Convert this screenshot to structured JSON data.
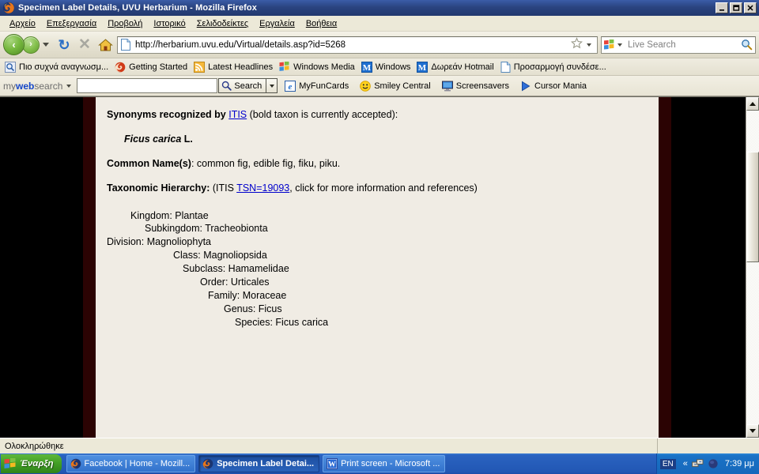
{
  "window": {
    "title": "Specimen Label Details, UVU Herbarium - Mozilla Firefox",
    "app_icon": "firefox-icon",
    "minimize_label": "_",
    "maximize_label": "❐",
    "close_label": "✕"
  },
  "menubar": {
    "items": [
      {
        "label": "Αρχείο",
        "accel": "Α"
      },
      {
        "label": "Επεξεργασία",
        "accel": "Ε"
      },
      {
        "label": "Προβολή",
        "accel": "β"
      },
      {
        "label": "Ιστορικό",
        "accel": "Ι"
      },
      {
        "label": "Σελιδοδείκτες",
        "accel": "Σ"
      },
      {
        "label": "Εργαλεία",
        "accel": "γ"
      },
      {
        "label": "Βοήθεια",
        "accel": "Β"
      }
    ]
  },
  "navbar": {
    "back_label": "‹",
    "forward_label": "›",
    "reload_label": "↻",
    "stop_label": "✕",
    "home_label": "home-icon",
    "url": "http://herbarium.uvu.edu/Virtual/details.asp?id=5268",
    "bookmark_star": "star-icon",
    "search_placeholder": "Live Search",
    "search_engine": "windows-live-icon",
    "search_go": "magnifier-icon"
  },
  "bookmarks": {
    "items": [
      {
        "label": "Πιο συχνά αναγνωσμ...",
        "icon": "most-visited-icon"
      },
      {
        "label": "Getting Started",
        "icon": "firefox-start-icon"
      },
      {
        "label": "Latest Headlines",
        "icon": "rss-icon"
      },
      {
        "label": "Windows Media",
        "icon": "windows-icon"
      },
      {
        "label": "Windows",
        "icon": "msn-icon"
      },
      {
        "label": "Δωρεάν Hotmail",
        "icon": "msn-icon"
      },
      {
        "label": "Προσαρμογή συνδέσε...",
        "icon": "page-icon"
      }
    ]
  },
  "mywebsearch": {
    "logo_prefix": "my",
    "logo_mid": "web",
    "logo_suffix": "search",
    "input_value": "",
    "search_button": "Search",
    "items": [
      {
        "label": "MyFunCards",
        "icon": "myfuncards-icon"
      },
      {
        "label": "Smiley Central",
        "icon": "smiley-icon"
      },
      {
        "label": "Screensavers",
        "icon": "monitor-icon"
      },
      {
        "label": "Cursor Mania",
        "icon": "cursor-icon"
      }
    ]
  },
  "page": {
    "synonyms_label": "Synonyms recognized by ",
    "synonyms_link": "ITIS",
    "synonyms_suffix": " (bold taxon is currently accepted):",
    "accepted_taxon_italic": "Ficus carica",
    "accepted_taxon_author": " L.",
    "common_names_label": "Common Name(s)",
    "common_names_value": ": common fig, edible fig, fiku, piku.",
    "hierarchy_label": "Taxonomic Hierarchy:",
    "hierarchy_prefix": " (ITIS ",
    "hierarchy_link": "TSN=19093",
    "hierarchy_suffix": ", click for more information and references)",
    "hierarchy": [
      {
        "rank": "Kingdom",
        "value": "Plantae",
        "indent": 0
      },
      {
        "rank": "Subkingdom",
        "value": "Tracheobionta",
        "indent": 1
      },
      {
        "rank": "Division",
        "value": "Magnoliophyta",
        "indent": 2
      },
      {
        "rank": "Class",
        "value": "Magnoliopsida",
        "indent": 3
      },
      {
        "rank": "Subclass",
        "value": "Hamamelidae",
        "indent": 4
      },
      {
        "rank": "Order",
        "value": "Urticales",
        "indent": 5
      },
      {
        "rank": "Family",
        "value": "Moraceae",
        "indent": 6
      },
      {
        "rank": "Genus",
        "value": "Ficus",
        "indent": 7
      },
      {
        "rank": "Species",
        "value": "Ficus carica",
        "indent": 8
      }
    ]
  },
  "scrollbar": {
    "up_label": "▲",
    "down_label": "▼"
  },
  "statusbar": {
    "text": "Ολοκληρώθηκε"
  },
  "taskbar": {
    "start_label": "Έναρξη",
    "items": [
      {
        "label": "Facebook | Home - Mozill...",
        "icon": "firefox-icon",
        "active": false
      },
      {
        "label": "Specimen Label Detai...",
        "icon": "firefox-icon",
        "active": true
      },
      {
        "label": "Print screen - Microsoft ...",
        "icon": "word-icon",
        "active": false
      }
    ],
    "language": "EN",
    "tray_expand": "«",
    "clock": "7:39 μμ"
  },
  "colors": {
    "titlebar": "#2a4480",
    "paper": "#f0ece4",
    "maroon_border": "#2b0303",
    "link": "#0000cc",
    "taskbar": "#2257b4",
    "start_green": "#43a026"
  }
}
